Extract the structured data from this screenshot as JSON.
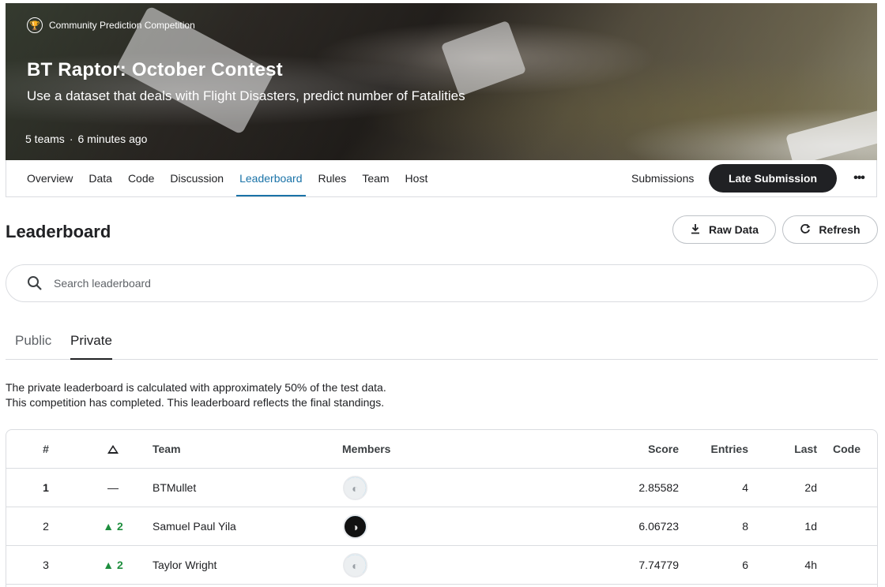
{
  "banner": {
    "badge": "Community Prediction Competition",
    "title": "BT Raptor: October Contest",
    "subtitle": "Use a dataset that deals with Flight Disasters, predict number of Fatalities",
    "teams": "5 teams",
    "separator": "·",
    "updated": "6 minutes ago"
  },
  "nav": {
    "tabs": [
      "Overview",
      "Data",
      "Code",
      "Discussion",
      "Leaderboard",
      "Rules",
      "Team",
      "Host"
    ],
    "active": "Leaderboard",
    "submissions": "Submissions",
    "late_submission": "Late Submission",
    "more": "•••"
  },
  "leaderboard": {
    "title": "Leaderboard",
    "raw_data": "Raw Data",
    "refresh": "Refresh",
    "search_placeholder": "Search leaderboard",
    "sub_tabs": {
      "public": "Public",
      "private": "Private",
      "active": "Private"
    },
    "note_line1": "The private leaderboard is calculated with approximately 50% of the test data.",
    "note_line2": "This competition has completed. This leaderboard reflects the final standings.",
    "columns": {
      "rank": "#",
      "team": "Team",
      "members": "Members",
      "score": "Score",
      "entries": "Entries",
      "last": "Last",
      "code": "Code"
    },
    "rows": [
      {
        "rank": "1",
        "delta": "—",
        "team": "BTMullet",
        "score": "2.85582",
        "entries": "4",
        "last": "2d"
      },
      {
        "rank": "2",
        "delta": "▲ 2",
        "team": "Samuel Paul Yila",
        "score": "6.06723",
        "entries": "8",
        "last": "1d"
      },
      {
        "rank": "3",
        "delta": "▲ 2",
        "team": "Taylor Wright",
        "score": "7.74779",
        "entries": "6",
        "last": "4h"
      }
    ]
  },
  "colors": {
    "accent": "#1a73a8",
    "positive": "#1e8e3e",
    "dark_button": "#202124"
  }
}
